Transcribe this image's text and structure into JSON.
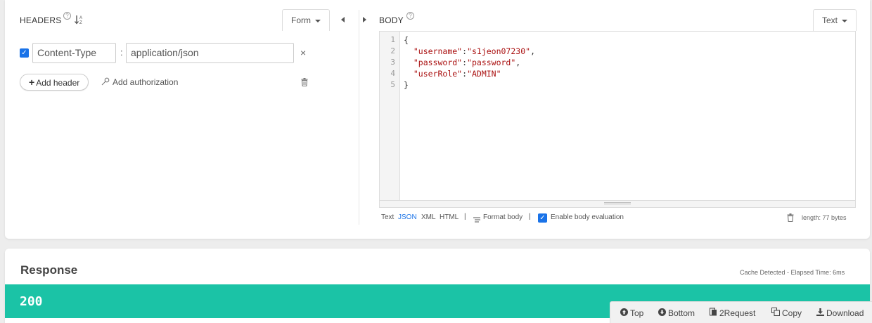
{
  "headers_panel": {
    "title": "HEADERS",
    "help_glyph": "?",
    "sort_glyph": "↓ᴬᶻ",
    "mode_label": "Form",
    "rows": [
      {
        "checked": true,
        "name": "Content-Type",
        "separator": ":",
        "value": "application/json",
        "remove_glyph": "×"
      }
    ],
    "add_header_label": "Add header",
    "add_auth_label": "Add authorization"
  },
  "body_panel": {
    "title": "BODY",
    "help_glyph": "?",
    "mode_label": "Text",
    "line_numbers": [
      "1",
      "2",
      "3",
      "4",
      "5"
    ],
    "code_lines": [
      {
        "open": "{"
      },
      {
        "key": "\"username\"",
        "sep": ":",
        "value": "\"s1jeon07230\"",
        "end": ","
      },
      {
        "key": "\"password\"",
        "sep": ":",
        "value": "\"password\"",
        "end": ","
      },
      {
        "key": "\"userRole\"",
        "sep": ":",
        "value": "\"ADMIN\"",
        "end": ""
      },
      {
        "close": "}"
      }
    ],
    "format_options": [
      "Text",
      "JSON",
      "XML",
      "HTML"
    ],
    "active_format": "JSON",
    "divider": "|",
    "format_body_label": "Format body",
    "enable_eval_label": "Enable body evaluation",
    "enable_eval_checked": true,
    "length_label": "length: 77 bytes"
  },
  "response": {
    "title": "Response",
    "cache_info": "Cache Detected - Elapsed Time: 6ms",
    "status_code": "200",
    "status_color": "#1bc3a6",
    "toolbar": {
      "top_label": "Top",
      "bottom_label": "Bottom",
      "request_label": "2Request",
      "copy_label": "Copy",
      "download_label": "Download"
    }
  },
  "icons": {
    "checkbox": "check-icon",
    "trash": "trash-icon",
    "key": "key-icon",
    "plus": "plus-icon"
  },
  "accent_color": "#1a73e8"
}
